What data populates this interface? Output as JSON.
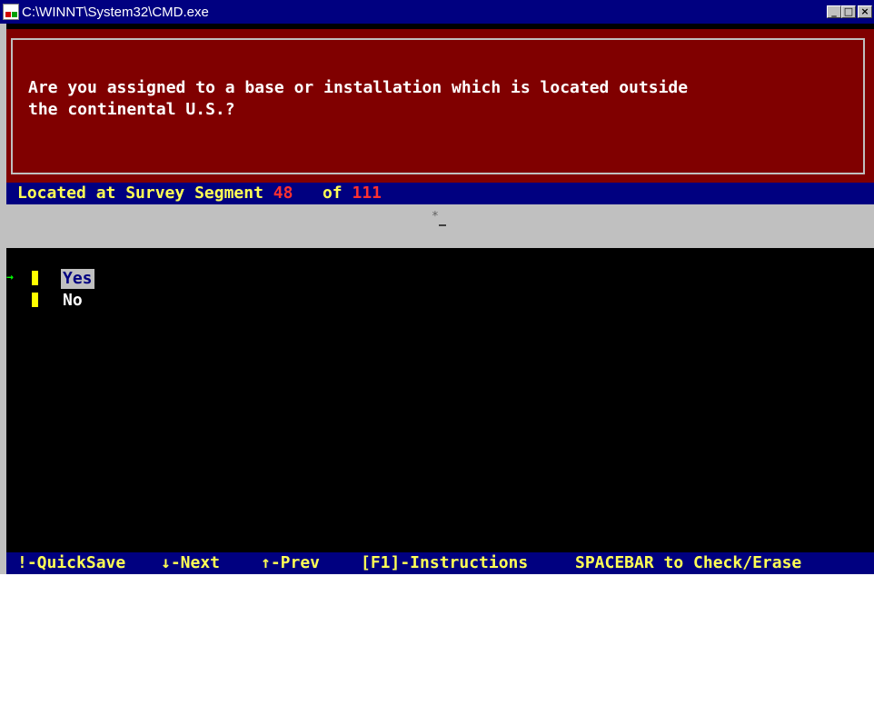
{
  "window": {
    "title": "C:\\WINNT\\System32\\CMD.exe",
    "buttons": {
      "minimize": "_",
      "maximize": "□",
      "close": "×"
    }
  },
  "question": {
    "line1": "Are you assigned to a base or installation which is located outside",
    "line2": "the continental U.S.?"
  },
  "status": {
    "prefix": "Located at Survey Segment ",
    "current": "48",
    "of_label": "of",
    "total": "111"
  },
  "input": {
    "marker": "*"
  },
  "options": [
    {
      "label": "Yes",
      "selected": true,
      "pointer": "→"
    },
    {
      "label": "No",
      "selected": false,
      "pointer": ""
    }
  ],
  "footer": {
    "quicksave": "!-QuickSave",
    "next": "↓-Next",
    "prev": "↑-Prev",
    "instructions": "[F1]-Instructions",
    "spacebar": "SPACEBAR to Check/Erase"
  },
  "colors": {
    "titlebar": "#000080",
    "question_bg": "#800000",
    "status_text": "#ffff55",
    "status_number": "#ff3030",
    "option_box": "#ffff00",
    "pointer": "#00ff00"
  }
}
